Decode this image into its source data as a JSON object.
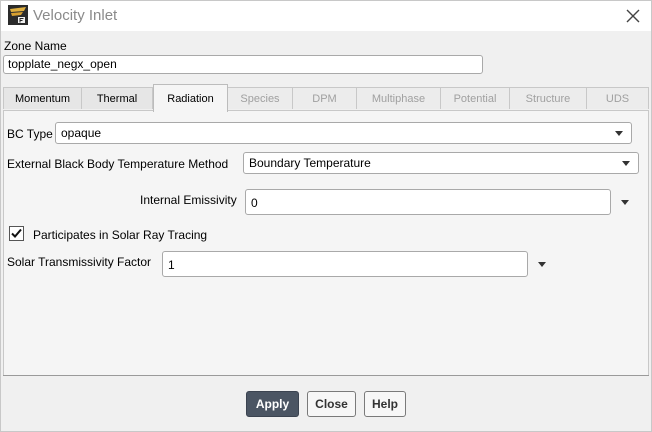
{
  "window": {
    "title": "Velocity Inlet",
    "accent": "#4b5563"
  },
  "zone": {
    "label": "Zone Name",
    "value": "topplate_negx_open"
  },
  "tabs": [
    {
      "label": "Momentum",
      "state": "enabled"
    },
    {
      "label": "Thermal",
      "state": "enabled"
    },
    {
      "label": "Radiation",
      "state": "active"
    },
    {
      "label": "Species",
      "state": "disabled"
    },
    {
      "label": "DPM",
      "state": "disabled"
    },
    {
      "label": "Multiphase",
      "state": "disabled"
    },
    {
      "label": "Potential",
      "state": "disabled"
    },
    {
      "label": "Structure",
      "state": "disabled"
    },
    {
      "label": "UDS",
      "state": "disabled"
    }
  ],
  "radiation": {
    "bc_type_label": "BC Type",
    "bc_type_value": "opaque",
    "ext_bb_method_label": "External Black Body Temperature Method",
    "ext_bb_method_value": "Boundary Temperature",
    "internal_emissivity_label": "Internal Emissivity",
    "internal_emissivity_value": "0",
    "solar_ray_tracing_label": "Participates in Solar Ray Tracing",
    "solar_ray_tracing_checked": true,
    "solar_transmissivity_label": "Solar Transmissivity Factor",
    "solar_transmissivity_value": "1"
  },
  "buttons": {
    "apply": "Apply",
    "close": "Close",
    "help": "Help"
  }
}
